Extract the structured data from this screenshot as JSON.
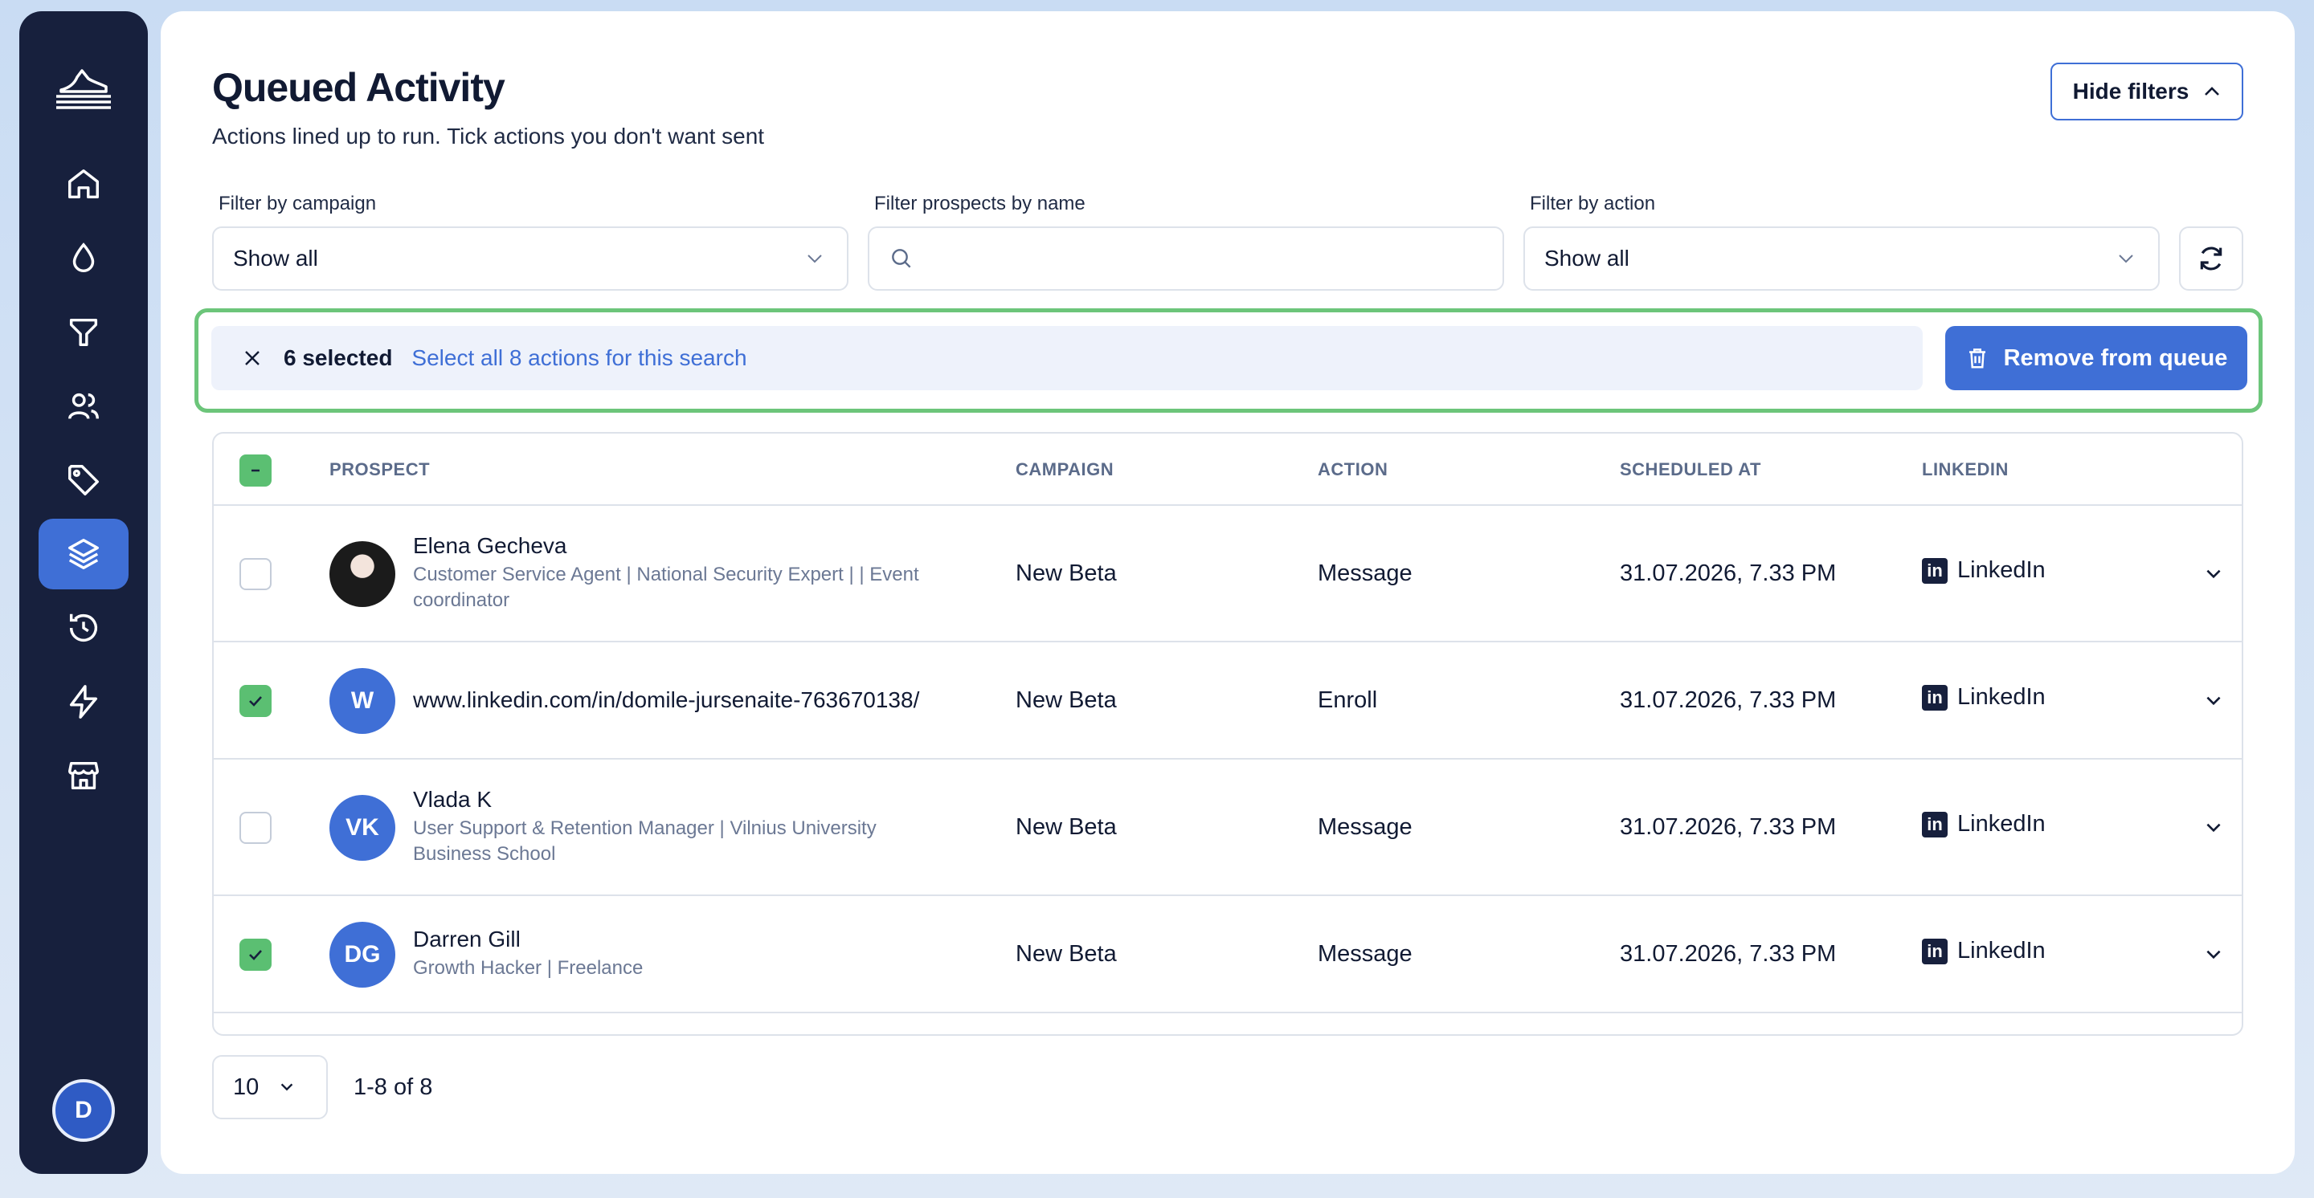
{
  "sidebar": {
    "items": [
      {
        "icon": "home-icon"
      },
      {
        "icon": "drop-icon"
      },
      {
        "icon": "funnel-icon"
      },
      {
        "icon": "users-icon"
      },
      {
        "icon": "tag-icon"
      },
      {
        "icon": "layers-icon",
        "active": true
      },
      {
        "icon": "history-icon"
      },
      {
        "icon": "bolt-icon"
      },
      {
        "icon": "store-icon"
      }
    ],
    "user_initial": "D"
  },
  "header": {
    "title": "Queued Activity",
    "subtitle": "Actions lined up to run. Tick actions you don't want sent",
    "hide_filters_label": "Hide filters"
  },
  "filters": {
    "campaign": {
      "label": "Filter by campaign",
      "value": "Show all"
    },
    "prospects": {
      "label": "Filter prospects by name",
      "placeholder": ""
    },
    "action": {
      "label": "Filter by action",
      "value": "Show all"
    }
  },
  "selection": {
    "count_label": "6 selected",
    "select_all_label": "Select all 8 actions for this search",
    "remove_label": "Remove from queue"
  },
  "table": {
    "headers": {
      "prospect": "PROSPECT",
      "campaign": "CAMPAIGN",
      "action": "ACTION",
      "scheduled": "SCHEDULED AT",
      "linkedin": "LINKEDIN"
    },
    "rows": [
      {
        "checked": false,
        "avatar": "",
        "name": "Elena Gecheva",
        "desc": "Customer Service Agent | National Security Expert | | Event coordinator",
        "campaign": "New Beta",
        "action": "Message",
        "scheduled": "31.07.2026, 7.33 PM",
        "linkedin": "LinkedIn"
      },
      {
        "checked": true,
        "avatar": "W",
        "name": "www.linkedin.com/in/domile-jursenaite-763670138/",
        "desc": "",
        "campaign": "New Beta",
        "action": "Enroll",
        "scheduled": "31.07.2026, 7.33 PM",
        "linkedin": "LinkedIn"
      },
      {
        "checked": false,
        "avatar": "VK",
        "name": "Vlada K",
        "desc": "User Support & Retention Manager | Vilnius University Business School",
        "campaign": "New Beta",
        "action": "Message",
        "scheduled": "31.07.2026, 7.33 PM",
        "linkedin": "LinkedIn"
      },
      {
        "checked": true,
        "avatar": "DG",
        "name": "Darren Gill",
        "desc": "Growth Hacker | Freelance",
        "campaign": "New Beta",
        "action": "Message",
        "scheduled": "31.07.2026, 7.33 PM",
        "linkedin": "LinkedIn"
      }
    ]
  },
  "pagination": {
    "per_page": "10",
    "range": "1-8 of 8"
  },
  "colors": {
    "accent": "#3f6fd6",
    "sidebar": "#17203d",
    "success": "#5bbf72",
    "highlight_border": "#6cc57a"
  }
}
